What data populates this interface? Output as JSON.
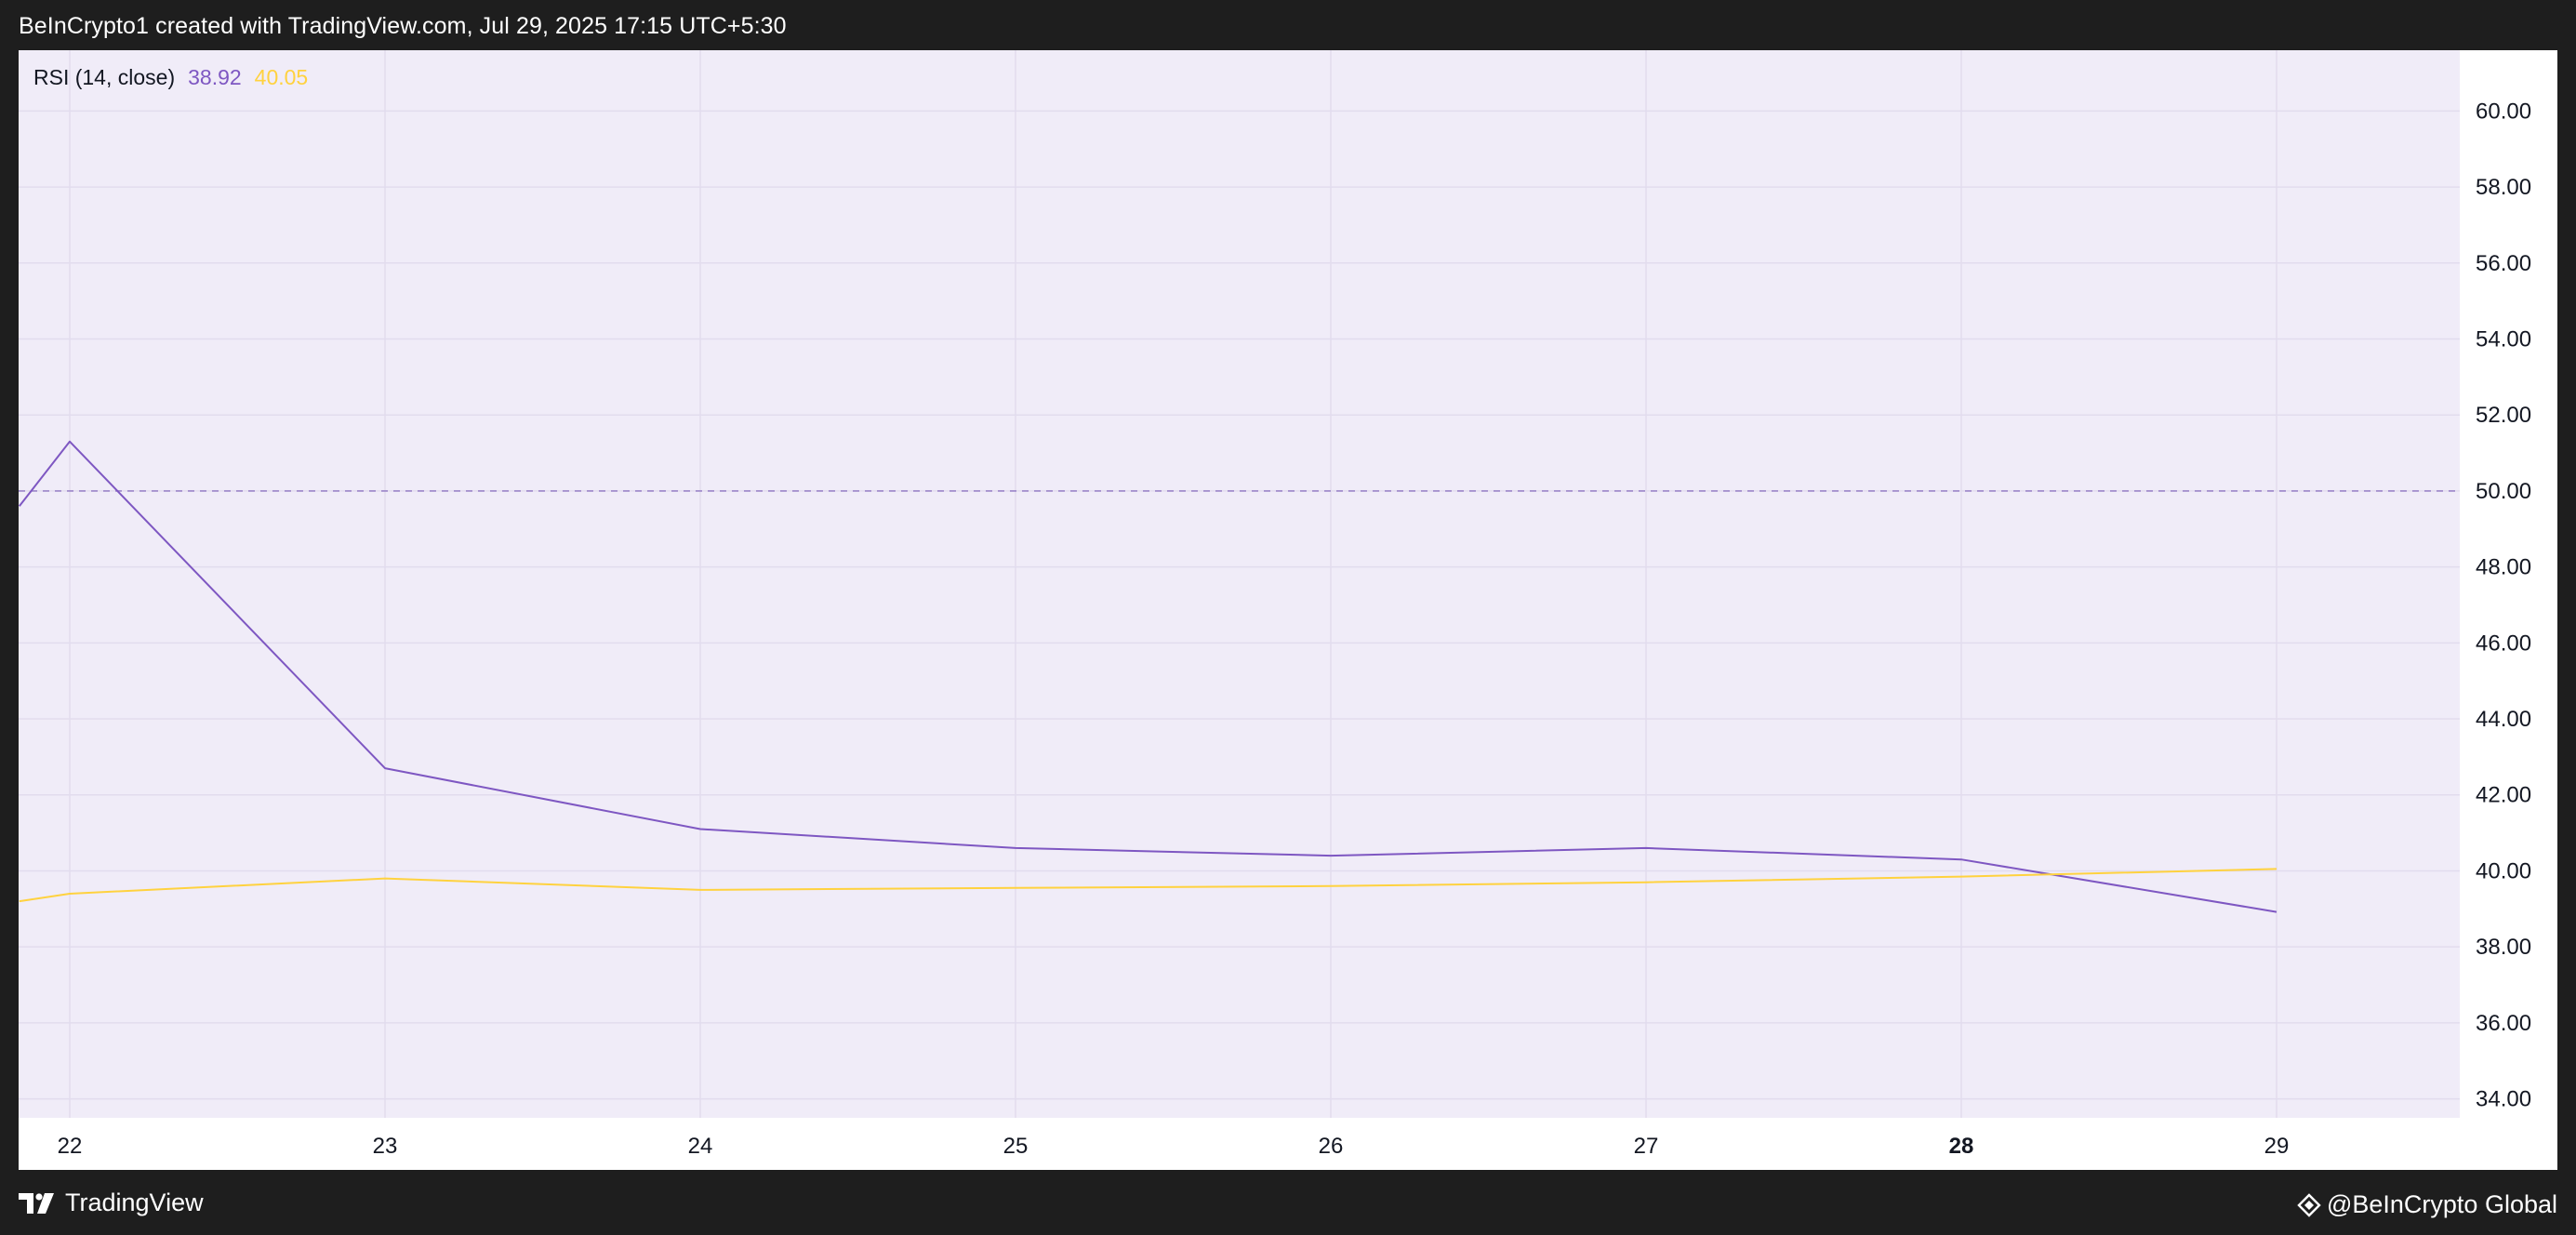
{
  "header": {
    "caption": "BeInCrypto1 created with TradingView.com, Jul 29, 2025 17:15 UTC+5:30"
  },
  "indicator": {
    "name": "RSI (14, close)",
    "rsi_value": "38.92",
    "ma_value": "40.05"
  },
  "footer": {
    "brand": "TradingView",
    "watermark": "@BeInCrypto Global"
  },
  "colors": {
    "rsi_line": "#7e57c2",
    "ma_line": "#ffd23f",
    "plot_bg": "#f0ecf8",
    "midline": "#9c86c9"
  },
  "chart_data": {
    "type": "line",
    "x_categories": [
      "22",
      "23",
      "24",
      "25",
      "26",
      "27",
      "28",
      "29"
    ],
    "x_bold": [
      "28"
    ],
    "y_ticks": [
      "34.00",
      "36.00",
      "38.00",
      "40.00",
      "42.00",
      "44.00",
      "46.00",
      "48.00",
      "50.00",
      "52.00",
      "54.00",
      "56.00",
      "58.00",
      "60.00"
    ],
    "ylim": [
      33.5,
      61.6
    ],
    "reference_line": 50,
    "series": [
      {
        "color": "#7e57c2",
        "points": [
          [
            21.84,
            49.6
          ],
          [
            22,
            51.3
          ],
          [
            23,
            42.7
          ],
          [
            24,
            41.1
          ],
          [
            25,
            40.6
          ],
          [
            26,
            40.4
          ],
          [
            27,
            40.6
          ],
          [
            28,
            40.3
          ],
          [
            29,
            38.92
          ]
        ]
      },
      {
        "color": "#ffd23f",
        "points": [
          [
            21.84,
            39.2
          ],
          [
            22,
            39.4
          ],
          [
            23,
            39.8
          ],
          [
            24,
            39.5
          ],
          [
            25,
            39.55
          ],
          [
            26,
            39.6
          ],
          [
            27,
            39.7
          ],
          [
            28,
            39.85
          ],
          [
            29,
            40.05
          ]
        ]
      }
    ]
  }
}
